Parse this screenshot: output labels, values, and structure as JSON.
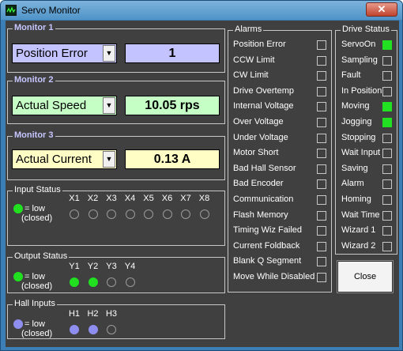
{
  "window": {
    "title": "Servo Monitor",
    "close_glyph": "✕"
  },
  "monitors": [
    {
      "label": "Monitor 1",
      "selection": "Position Error",
      "value": "1",
      "readout_color": "#c3c3ff"
    },
    {
      "label": "Monitor 2",
      "selection": "Actual Speed",
      "value": "10.05 rps",
      "readout_color": "#c5ffc5"
    },
    {
      "label": "Monitor 3",
      "selection": "Actual Current",
      "value": "0.13 A",
      "readout_color": "#ffffc5"
    }
  ],
  "input_status": {
    "label": "Input Status",
    "legend_line1": "= low",
    "legend_line2": "(closed)",
    "channels": [
      "X1",
      "X2",
      "X3",
      "X4",
      "X5",
      "X6",
      "X7",
      "X8"
    ],
    "active": [
      false,
      false,
      false,
      false,
      false,
      false,
      false,
      false
    ]
  },
  "output_status": {
    "label": "Output Status",
    "legend_line1": "= low",
    "legend_line2": "(closed)",
    "channels": [
      "Y1",
      "Y2",
      "Y3",
      "Y4"
    ],
    "active": [
      true,
      true,
      false,
      false
    ]
  },
  "hall_inputs": {
    "label": "Hall Inputs",
    "legend_line1": "= low",
    "legend_line2": "(closed)",
    "channels": [
      "H1",
      "H2",
      "H3"
    ],
    "active": [
      true,
      true,
      false
    ]
  },
  "alarms": {
    "label": "Alarms",
    "items": [
      {
        "label": "Position Error",
        "active": false
      },
      {
        "label": "CCW Limit",
        "active": false
      },
      {
        "label": "CW Limit",
        "active": false
      },
      {
        "label": "Drive Overtemp",
        "active": false
      },
      {
        "label": "Internal Voltage",
        "active": false
      },
      {
        "label": "Over Voltage",
        "active": false
      },
      {
        "label": "Under Voltage",
        "active": false
      },
      {
        "label": "Motor Short",
        "active": false
      },
      {
        "label": "Bad Hall Sensor",
        "active": false
      },
      {
        "label": "Bad Encoder",
        "active": false
      },
      {
        "label": "Communication",
        "active": false
      },
      {
        "label": "Flash Memory",
        "active": false
      },
      {
        "label": "Timing Wiz Failed",
        "active": false
      },
      {
        "label": "Current Foldback",
        "active": false
      },
      {
        "label": "Blank Q Segment",
        "active": false
      },
      {
        "label": "Move While Disabled",
        "active": false
      }
    ]
  },
  "drive_status": {
    "label": "Drive Status",
    "items": [
      {
        "label": "ServoOn",
        "active": true
      },
      {
        "label": "Sampling",
        "active": false
      },
      {
        "label": "Fault",
        "active": false
      },
      {
        "label": "In Position",
        "active": false
      },
      {
        "label": "Moving",
        "active": true
      },
      {
        "label": "Jogging",
        "active": true
      },
      {
        "label": "Stopping",
        "active": false
      },
      {
        "label": "Wait Input",
        "active": false
      },
      {
        "label": "Saving",
        "active": false
      },
      {
        "label": "Alarm",
        "active": false
      },
      {
        "label": "Homing",
        "active": false
      },
      {
        "label": "Wait Time",
        "active": false
      },
      {
        "label": "Wizard 1",
        "active": false
      },
      {
        "label": "Wizard 2",
        "active": false
      }
    ]
  },
  "close_button": {
    "label": "Close"
  },
  "colors": {
    "client_bg": "#404040",
    "indicator_green": "#20e020",
    "indicator_blue": "#8e8ef0"
  }
}
